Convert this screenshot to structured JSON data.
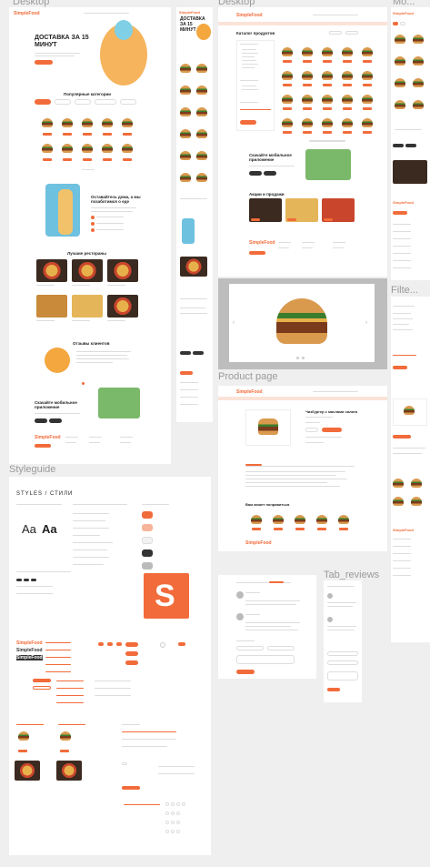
{
  "frames": {
    "desktop1": "Desktop",
    "desktop2": "Desktop",
    "mobile": "Mo...",
    "product": "Product page",
    "styleguide": "Styleguide",
    "filter": "Filte...",
    "tab_reviews": "Tab_reviews"
  },
  "landing": {
    "brand": "SimpleFood",
    "hero_title": "ДОСТАВКА ЗА 15 МИНУТ",
    "popular_title": "Популярные категории",
    "app_title": "Оставайтесь дома, а мы позаботимся о еде",
    "restaurants_title": "Лучшие рестораны",
    "reviews_title": "Отзывы клиентов",
    "download_title": "Скачайте мобильное приложение"
  },
  "catalog": {
    "title": "Каталог продуктов",
    "download_title": "Скачайте мобильное приложение",
    "promo_title": "Акции и продажи",
    "footer_brand": "SimpleFood"
  },
  "product": {
    "brand": "SimpleFood",
    "name": "Чизбургер с маслами салата",
    "similar_title": "Вам может понравиться",
    "footer_brand": "SimpleFood"
  },
  "styleguide": {
    "title": "STYLES / СТИЛИ",
    "sample": "Aa",
    "logo_letter": "S",
    "brand": "SimpleFood"
  },
  "colors": {
    "accent": "#f26b3a",
    "dark": "#333333",
    "board": "#ffffff",
    "canvas": "#efefef"
  }
}
